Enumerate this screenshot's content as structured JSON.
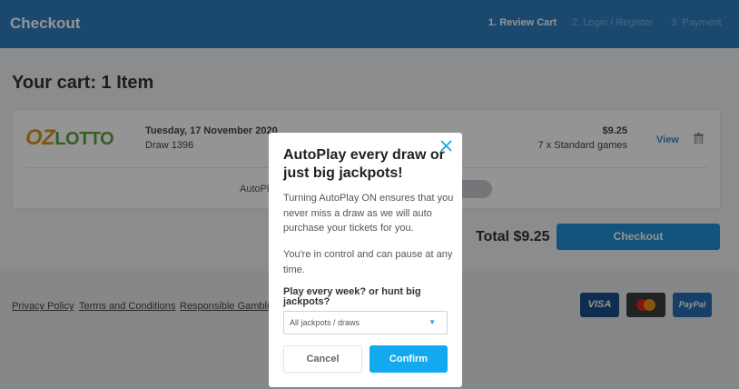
{
  "header": {
    "title": "Checkout",
    "steps": [
      "1. Review Cart",
      "2. Login / Register",
      "3. Payment"
    ]
  },
  "cart": {
    "title": "Your cart: 1 Item",
    "item": {
      "logo_part1": "OZ",
      "logo_part2": "LOTTO",
      "date": "Tuesday, 17 November 2020",
      "draw": "Draw 1396",
      "price": "$9.25",
      "games": "7 x Standard games",
      "view_label": "View",
      "autoplay_label": "AutoPlay"
    },
    "total": "Total $9.25",
    "checkout_label": "Checkout"
  },
  "footer": {
    "links": [
      "Privacy Policy",
      "Terms and Conditions",
      "Responsible Gambling"
    ],
    "payments": [
      "VISA",
      "PayPal"
    ]
  },
  "modal": {
    "title": "AutoPlay every draw or just big jackpots!",
    "para1": "Turning AutoPlay ON ensures that you never miss a draw as we will auto purchase your tickets for you.",
    "para2": "You're in control and can pause at any time.",
    "question": "Play every week? or hunt big jackpots?",
    "select_value": "All jackpots / draws",
    "cancel_label": "Cancel",
    "confirm_label": "Confirm"
  },
  "colors": {
    "header": "#2f7dc0",
    "accent": "#12a9ef",
    "checkout": "#1f8fd6"
  },
  "icons": [
    "close-icon",
    "trash-icon",
    "caret-down-icon",
    "mastercard-icon"
  ]
}
